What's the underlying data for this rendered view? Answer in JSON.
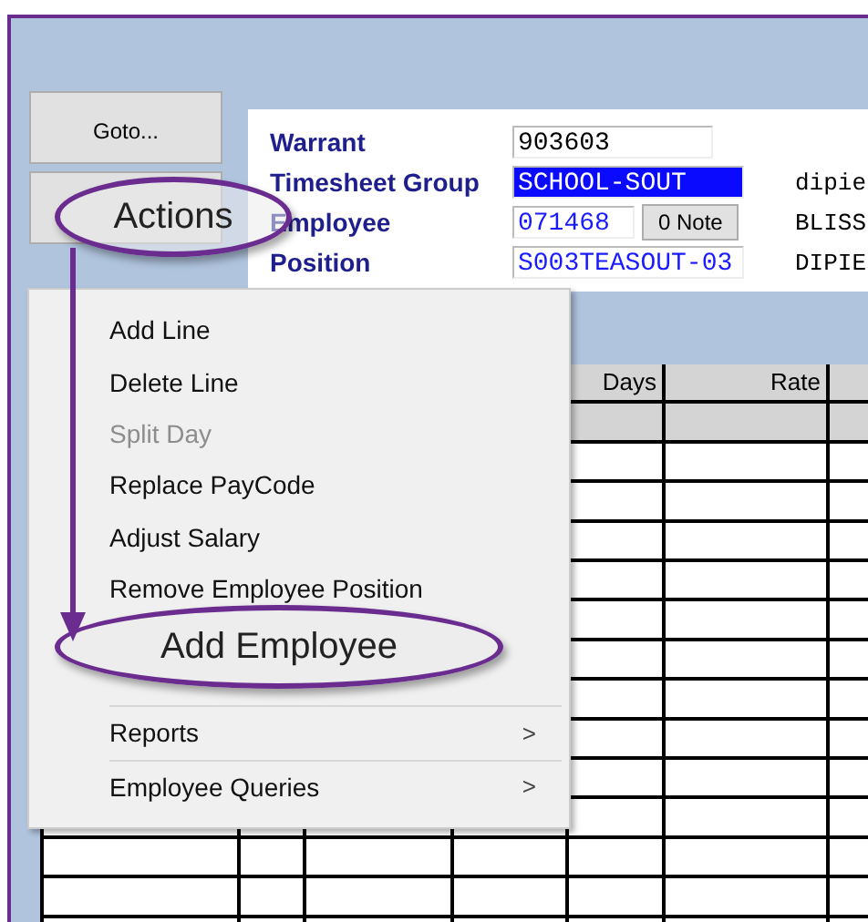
{
  "goto_button": "Goto...",
  "fields": [
    {
      "label": "Warrant",
      "value": "903603",
      "linked": false,
      "selected": false
    },
    {
      "label": "Timesheet Group",
      "value": "SCHOOL-SOUT",
      "linked": true,
      "selected": true,
      "side_text": "dipie"
    },
    {
      "label": "Employee",
      "value": "071468",
      "linked": true,
      "selected": false,
      "note_button": "0 Note",
      "side_text": "BLISS"
    },
    {
      "label": "Position",
      "value": "S003TEASOUT-03",
      "linked": true,
      "selected": false,
      "side_text": "DIPIE"
    }
  ],
  "grid": {
    "columns": [
      {
        "label": "Days"
      },
      {
        "label": "Rate"
      }
    ]
  },
  "menu": {
    "items": [
      {
        "kind": "item",
        "label": "Add Line",
        "disabled": false
      },
      {
        "kind": "item",
        "label": "Delete Line",
        "disabled": false
      },
      {
        "kind": "item",
        "label": "Split Day",
        "disabled": true
      },
      {
        "kind": "item",
        "label": "Replace PayCode",
        "disabled": false
      },
      {
        "kind": "item",
        "label": "Adjust Salary",
        "disabled": false
      },
      {
        "kind": "item",
        "label": "Remove Employee Position",
        "disabled": false
      },
      {
        "kind": "covered"
      },
      {
        "kind": "separator"
      },
      {
        "kind": "submenu",
        "label": "Reports",
        "disabled": false,
        "arrow": ">"
      },
      {
        "kind": "separator"
      },
      {
        "kind": "submenu",
        "label": "Employee Queries",
        "disabled": false,
        "arrow": ">"
      }
    ]
  },
  "callouts": [
    {
      "label": "Actions"
    },
    {
      "label": "Add Employee"
    }
  ]
}
